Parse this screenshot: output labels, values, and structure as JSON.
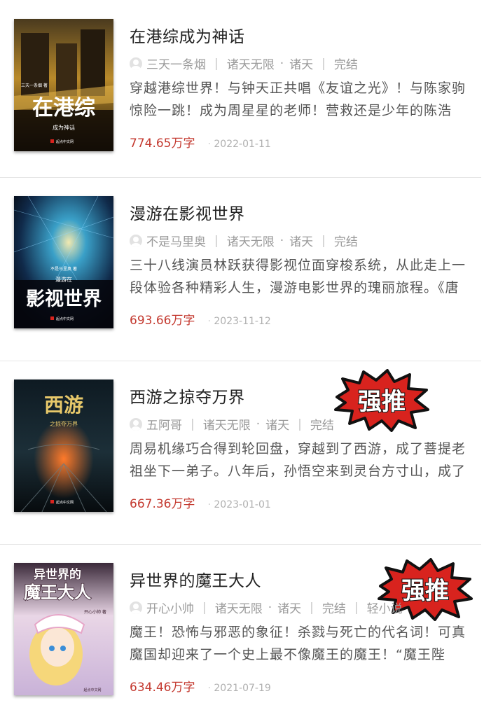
{
  "books": [
    {
      "title": "在港综成为神话",
      "author": "三天一条烟",
      "category": "诸天无限",
      "subcategory": "诸天",
      "status": "完结",
      "extra_tag": "",
      "description": "穿越港综世界！与钟天正共唱《友谊之光》！与陈家驹惊险一跳！成为周星星的老师！营救还是少年的陈浩",
      "word_count": "774.65万字",
      "date": "2022-01-11",
      "badge": "",
      "cover": {
        "big": "在港综",
        "small": "成为神话",
        "author": "三天一条烟 著",
        "publisher": "起点中文网"
      }
    },
    {
      "title": "漫游在影视世界",
      "author": "不是马里奥",
      "category": "诸天无限",
      "subcategory": "诸天",
      "status": "完结",
      "extra_tag": "",
      "description": "三十八线演员林跃获得影视位面穿梭系统，从此走上一段体验各种精彩人生，漫游电影世界的瑰丽旅程。《唐",
      "word_count": "693.66万字",
      "date": "2023-11-12",
      "badge": "",
      "cover": {
        "big": "影视世界",
        "small": "漫游在",
        "author": "不是马里奥 著",
        "publisher": "起点中文网"
      }
    },
    {
      "title": "西游之掠夺万界",
      "author": "五阿哥",
      "category": "诸天无限",
      "subcategory": "诸天",
      "status": "完结",
      "extra_tag": "",
      "description": "周易机缘巧合得到轮回盘，穿越到了西游，成了菩提老祖坐下一弟子。八年后，孙悟空来到灵台方寸山，成了",
      "word_count": "667.36万字",
      "date": "2023-01-01",
      "badge": "强推",
      "cover": {
        "big": "西游",
        "small": "之掠夺万界",
        "author": "",
        "publisher": "起点中文网"
      }
    },
    {
      "title": "异世界的魔王大人",
      "author": "开心小帅",
      "category": "诸天无限",
      "subcategory": "诸天",
      "status": "完结",
      "extra_tag": "轻小说",
      "description": "魔王！恐怖与邪恶的象征！杀戮与死亡的代名词！可真魔国却迎来了一个史上最不像魔王的魔王！“魔王陛",
      "word_count": "634.46万字",
      "date": "2021-07-19",
      "badge": "强推",
      "cover": {
        "big": "魔王大人",
        "small": "异世界的",
        "author": "开心小帅 著",
        "publisher": "起点中文网"
      }
    }
  ],
  "colors": {
    "accent_red": "#c43a30",
    "badge_red": "#d8231e",
    "meta_gray": "#9a9a9a",
    "divider": "#e6e6e6"
  },
  "icons": {
    "avatar": "user-avatar-icon"
  }
}
